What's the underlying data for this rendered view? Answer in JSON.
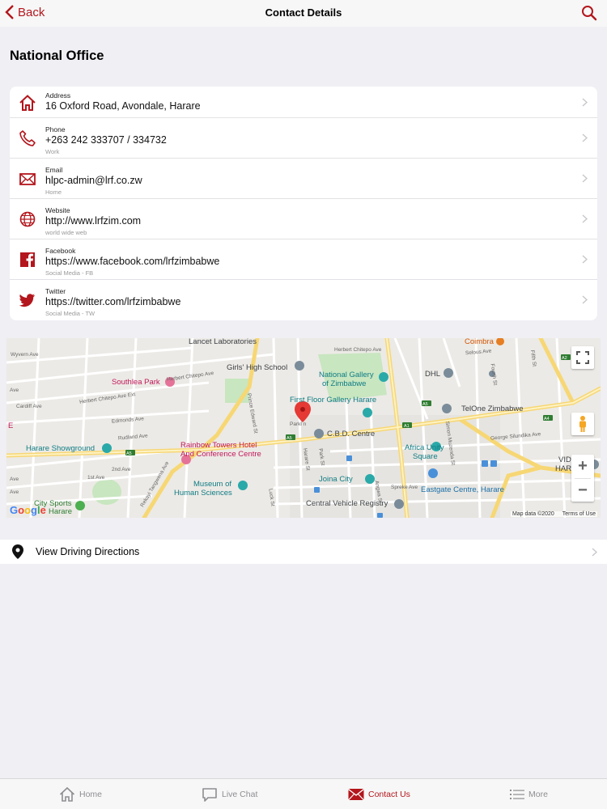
{
  "nav": {
    "back_label": "Back",
    "title": "Contact Details"
  },
  "section_title": "National Office",
  "contacts": [
    {
      "label": "Address",
      "value": "16 Oxford Road, Avondale, Harare",
      "sub": "",
      "icon": "home-icon"
    },
    {
      "label": "Phone",
      "value": "+263 242 333707 / 334732",
      "sub": "Work",
      "icon": "phone-icon"
    },
    {
      "label": "Email",
      "value": "hlpc-admin@lrf.co.zw",
      "sub": "Home",
      "icon": "mail-icon"
    },
    {
      "label": "Website",
      "value": "http://www.lrfzim.com",
      "sub": "world wide web",
      "icon": "globe-icon"
    },
    {
      "label": "Facebook",
      "value": "https://www.facebook.com/lrfzimbabwe",
      "sub": "Social Media - FB",
      "icon": "facebook-icon"
    },
    {
      "label": "Twitter",
      "value": "https://twitter.com/lrfzimbabwe",
      "sub": "Social Media - TW",
      "icon": "twitter-icon"
    }
  ],
  "map": {
    "labels": {
      "lancet": "Lancet Laboratories",
      "herbert1": "Herbert Chitepo Ave",
      "herbert2": "Herbert Chitepo Ave",
      "herbert3": "Herbert Chitepo Ave Ext",
      "girls_high": "Girls' High School",
      "national_gallery_1": "National Gallery",
      "national_gallery_2": "of Zimbabwe",
      "dhl": "DHL",
      "southlea": "Southlea Park",
      "first_floor": "First Floor Gallery Harare",
      "telone": "TelOne Zimbabwe",
      "cbd": "C.B.D. Centre",
      "showground": "Harare Showground",
      "rainbow_1": "Rainbow Towers Hotel",
      "rainbow_2": "And Conference Centre",
      "africa_unity_1": "Africa Unity",
      "africa_unity_2": "Square",
      "joina": "Joina City",
      "museum_1": "Museum of",
      "museum_2": "Human Sciences",
      "eastgate": "Eastgate Centre, Harare",
      "central_vehicle": "Central Vehicle Registry",
      "city_sports_1": "City Sports",
      "city_sports_2": "Harare",
      "vid_east_1": "VID EAST",
      "vid_east_2": "HAR",
      "wyvern": "Wyvern Ave",
      "cardiff": "Cardiff Ave",
      "edmonds": "Edmonds Ave",
      "rudland": "Rudland Ave",
      "prince_edward": "Prince Edward St",
      "simon_muzenda": "Simon Muzenda St",
      "angwa": "Angwa St",
      "rekayi": "Rekayi Tangwena Ave",
      "george": "George Silundika Ave",
      "selous": "Selous Ave",
      "spreke": "Spreke Ave",
      "park": "Park St",
      "harare_st": "Harare St",
      "parkl": "Parkl n",
      "coimbra": "Coimbra",
      "luck": "Luck St",
      "fourth": "Fourth St",
      "fifth": "Fifth St",
      "second": "2nd Ave",
      "first_ave": "1st Ave",
      "a5": "A5",
      "a1": "A1",
      "a2": "A2",
      "a4": "A4",
      "a4b": "A4",
      "a5b": "A5",
      "e_edge": "E",
      "ave_edge1": "Ave",
      "ave_edge2": "Ave",
      "ave_edge3": "Ave"
    },
    "google": "Google",
    "map_data": "Map data ©2020",
    "terms": "Terms of Use",
    "zoom_in": "+",
    "zoom_out": "−"
  },
  "directions_label": "View Driving Directions",
  "tabs": [
    {
      "label": "Home",
      "icon": "home-tab-icon"
    },
    {
      "label": "Live Chat",
      "icon": "chat-icon"
    },
    {
      "label": "Contact Us",
      "icon": "envelope-icon",
      "active": true
    },
    {
      "label": "More",
      "icon": "list-icon"
    }
  ],
  "colors": {
    "accent": "#b3161c",
    "road_major": "#f7d774",
    "park": "#c8e6c0"
  }
}
